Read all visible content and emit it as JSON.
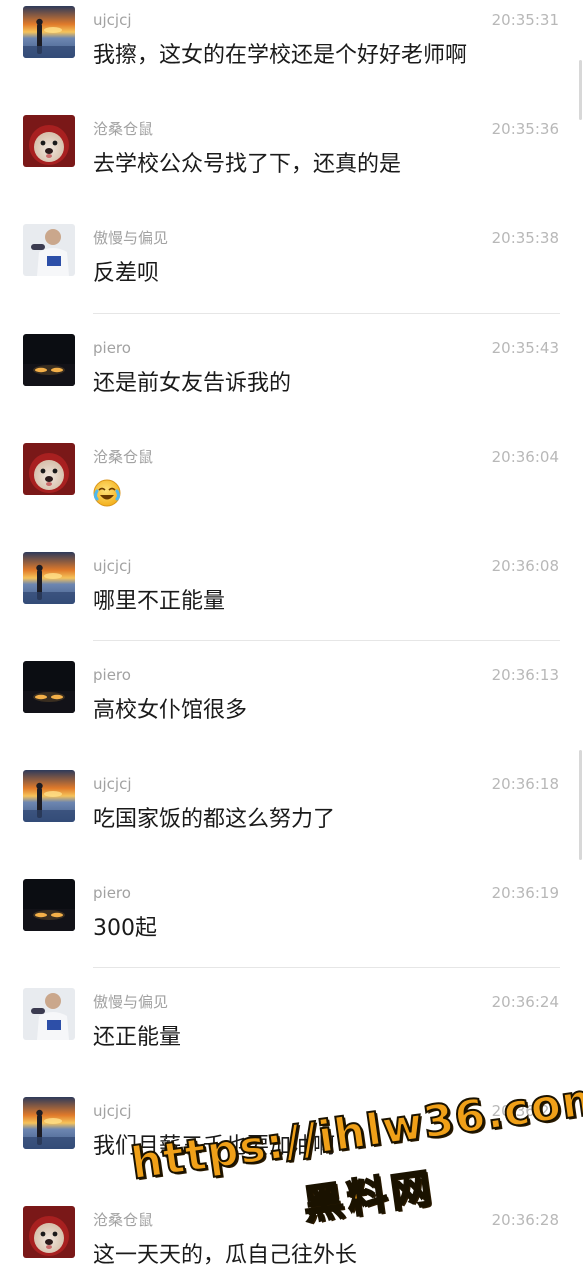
{
  "messages": [
    {
      "sender": "ujcjcj",
      "time": "20:35:31",
      "text": "我擦，这女的在学校还是个好好老师啊",
      "avatar": "sunset-portrait"
    },
    {
      "sender": "沧桑仓鼠",
      "time": "20:35:36",
      "text": "去学校公众号找了下，还真的是",
      "avatar": "dog-red-hat"
    },
    {
      "sender": "傲慢与偏见",
      "time": "20:35:38",
      "text": "反差呗",
      "avatar": "person-white-shirt"
    },
    {
      "sender": "piero",
      "time": "20:35:43",
      "text": "还是前女友告诉我的",
      "avatar": "night-car-lights"
    },
    {
      "sender": "沧桑仓鼠",
      "time": "20:36:04",
      "text": "",
      "emoji": "crying-laughing-emoji",
      "avatar": "dog-red-hat"
    },
    {
      "sender": "ujcjcj",
      "time": "20:36:08",
      "text": "哪里不正能量",
      "avatar": "sunset-portrait"
    },
    {
      "sender": "piero",
      "time": "20:36:13",
      "text": "高校女仆馆很多",
      "avatar": "night-car-lights"
    },
    {
      "sender": "ujcjcj",
      "time": "20:36:18",
      "text": "吃国家饭的都这么努力了",
      "avatar": "sunset-portrait"
    },
    {
      "sender": "piero",
      "time": "20:36:19",
      "text": "300起",
      "avatar": "night-car-lights"
    },
    {
      "sender": "傲慢与偏见",
      "time": "20:36:24",
      "text": "还正能量",
      "avatar": "person-white-shirt"
    },
    {
      "sender": "ujcjcj",
      "time": "20:36:26",
      "text": "我们月薪三千也要加油啊",
      "avatar": "sunset-portrait"
    },
    {
      "sender": "沧桑仓鼠",
      "time": "20:36:28",
      "text": "这一天天的，瓜自己往外长",
      "avatar": "dog-red-hat"
    }
  ],
  "watermark": {
    "url": "https://ihlw36.com",
    "name": "黑料网"
  },
  "colors": {
    "background": "#ffffff",
    "sender_text": "#a2a2a2",
    "time_text": "#b8b8b8",
    "message_text": "#1a1a1a",
    "divider": "#e6e6e6",
    "watermark_fill": "#f0a018"
  }
}
